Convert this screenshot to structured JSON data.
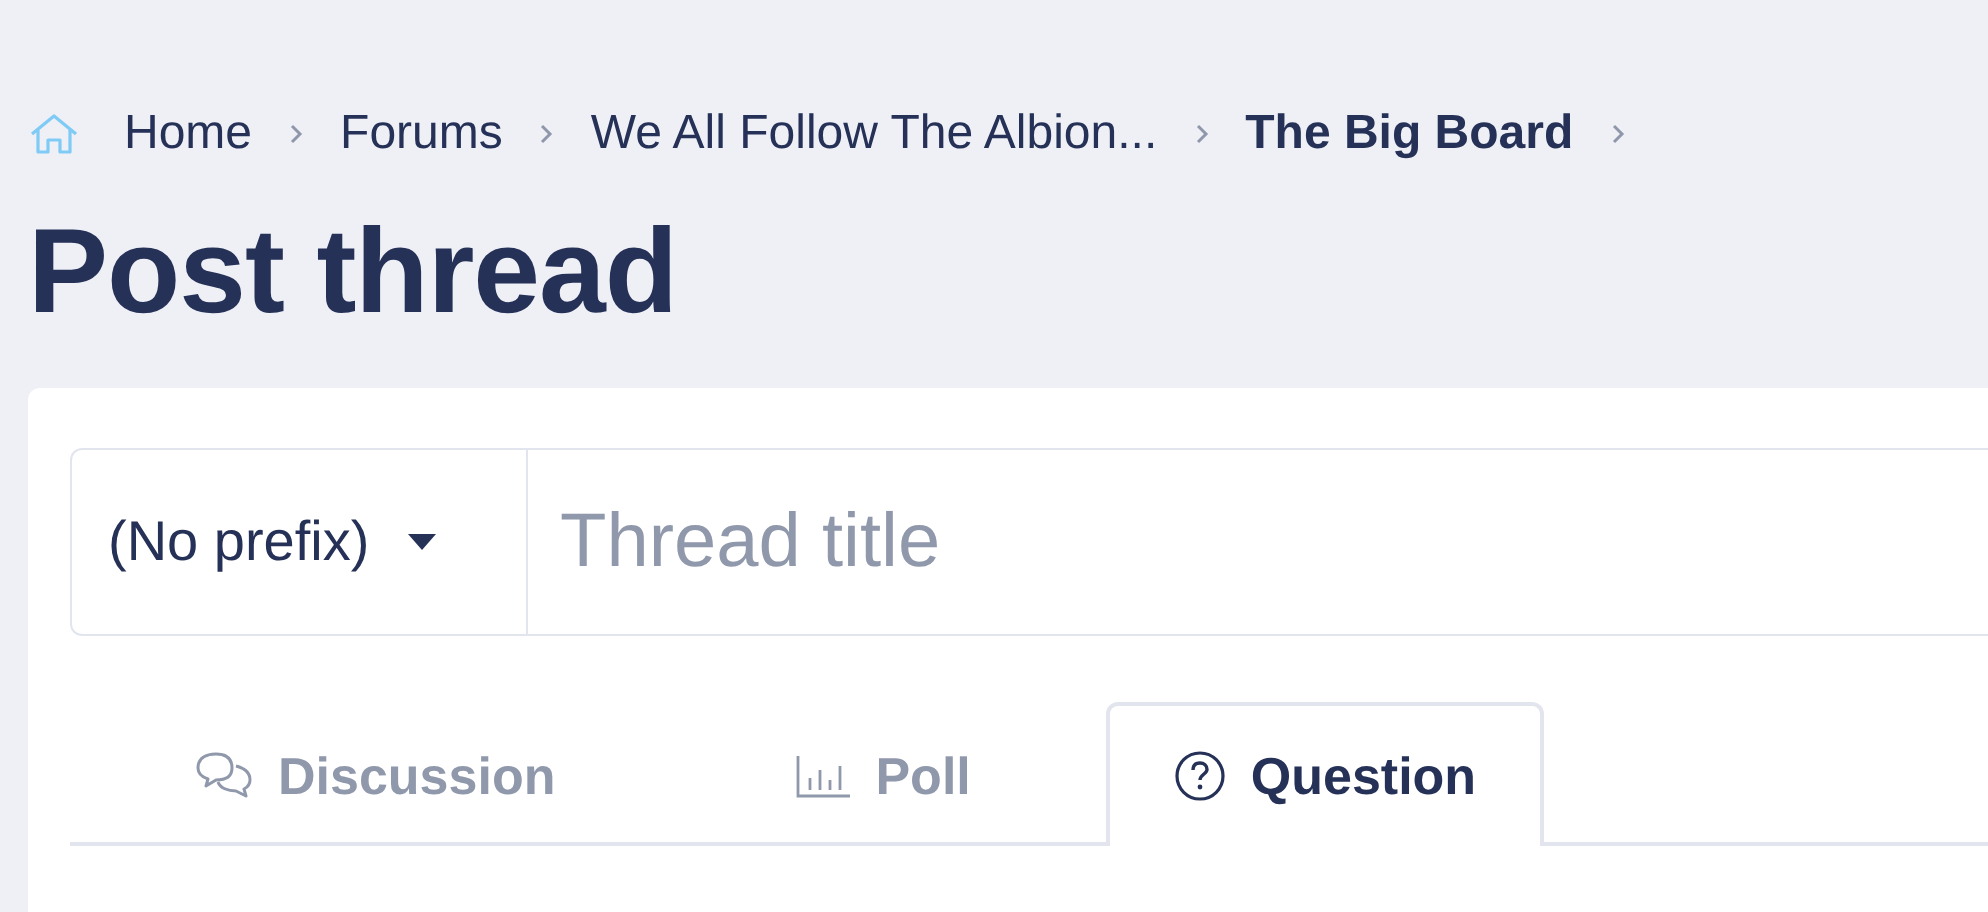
{
  "breadcrumb": [
    {
      "label": "Home",
      "kind": "home"
    },
    {
      "label": "Forums",
      "kind": "link"
    },
    {
      "label": "We All Follow The Albion...",
      "kind": "link"
    },
    {
      "label": "The Big Board",
      "kind": "current"
    }
  ],
  "title": "Post thread",
  "prefix": {
    "value": "(No prefix)"
  },
  "thread_title": {
    "placeholder": "Thread title"
  },
  "tabs": [
    {
      "label": "Discussion",
      "kind": "discussion",
      "selected": false
    },
    {
      "label": "Poll",
      "kind": "poll",
      "selected": false
    },
    {
      "label": "Question",
      "kind": "question",
      "selected": true
    }
  ]
}
